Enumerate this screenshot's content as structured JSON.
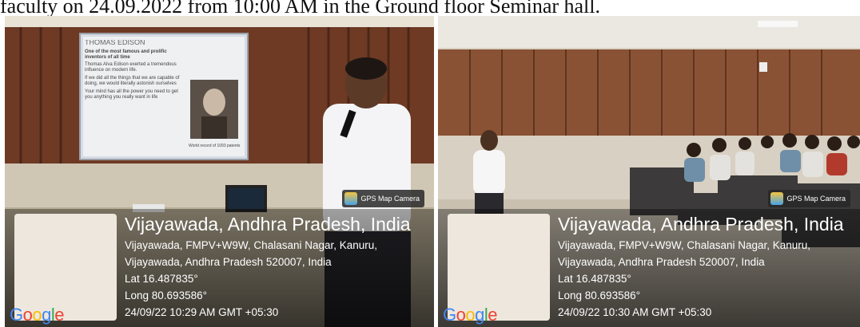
{
  "caption_top": "faculty on 24.09.2022 from 10:00 AM in the Ground floor Seminar hall.",
  "photos": [
    {
      "slide": {
        "title": "THOMAS EDISON",
        "bullet1": "One of the most famous and prolific inventors of all time",
        "bullet1_sub": "Thomas Alva Edison exerted a tremendous influence on modern life.",
        "bullet2": "If we did all the things that we are capable of doing, we would literally astonish ourselves",
        "bullet3": "Your mind has all the power you need to get you anything you really want in life",
        "portrait_caption": "World record of 1093 patents"
      },
      "badge": "GPS Map Camera",
      "city": "Vijayawada, Andhra Pradesh, India",
      "address1": "Vijayawada, FMPV+W9W, Chalasani Nagar, Kanuru,",
      "address2": "Vijayawada, Andhra Pradesh 520007, India",
      "lat": "Lat 16.487835°",
      "long": "Long 80.693586°",
      "timestamp": "24/09/22 10:29 AM GMT +05:30",
      "map_logo": "Google"
    },
    {
      "badge": "GPS Map Camera",
      "city": "Vijayawada, Andhra Pradesh, India",
      "address1": "Vijayawada, FMPV+W9W, Chalasani Nagar, Kanuru,",
      "address2": "Vijayawada, Andhra Pradesh 520007, India",
      "lat": "Lat 16.487835°",
      "long": "Long 80.693586°",
      "timestamp": "24/09/22 10:30 AM GMT +05:30",
      "map_logo": "Google"
    }
  ],
  "colors": {
    "google": [
      "#4285f4",
      "#ea4335",
      "#fbbc05",
      "#4285f4",
      "#34a853",
      "#ea4335"
    ]
  }
}
